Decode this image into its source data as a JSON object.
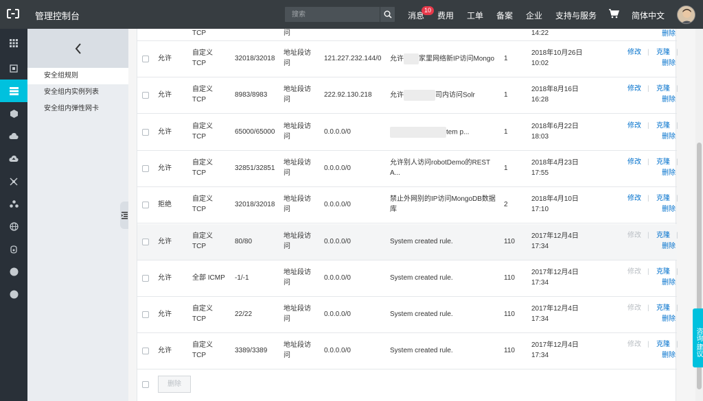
{
  "topbar": {
    "console_title": "管理控制台",
    "search_placeholder": "搜索",
    "nav": {
      "messages": "消息",
      "messages_badge": "10",
      "fees": "费用",
      "tickets": "工单",
      "icp": "备案",
      "enterprise": "企业",
      "support": "支持与服务",
      "language": "简体中文"
    }
  },
  "subnav": {
    "items": [
      {
        "label": "安全组规则"
      },
      {
        "label": "安全组内实例列表"
      },
      {
        "label": "安全组内弹性网卡"
      }
    ]
  },
  "table": {
    "top_partial": {
      "protocol": "TCP",
      "auth": "问",
      "date": "14:22",
      "delete": "删除"
    },
    "rows": [
      {
        "policy": "允许",
        "protocol1": "自定义",
        "protocol2": "TCP",
        "port": "32018/32018",
        "auth1": "地址段访",
        "auth2": "问",
        "object": "121.227.232.144/0",
        "desc_pre": "允许",
        "desc_post": "家里网络新IP访问Mongo",
        "desc_line2": "",
        "priority": "1",
        "date1": "2018年10月26日",
        "date2": "10:02",
        "edit": "修改",
        "clone": "克隆",
        "delete": "删除",
        "sep": "|"
      },
      {
        "policy": "允许",
        "protocol1": "自定义",
        "protocol2": "TCP",
        "port": "8983/8983",
        "auth1": "地址段访",
        "auth2": "问",
        "object": "222.92.130.218",
        "desc_pre": "允许",
        "desc_post": "司内访问Solr",
        "desc_line2": "",
        "priority": "1",
        "date1": "2018年8月16日",
        "date2": "16:28",
        "edit": "修改",
        "clone": "克隆",
        "delete": "删除",
        "sep": "|"
      },
      {
        "policy": "允许",
        "protocol1": "自定义",
        "protocol2": "TCP",
        "port": "65000/65000",
        "auth1": "地址段访",
        "auth2": "问",
        "object": "0.0.0.0/0",
        "desc_pre": "",
        "desc_post": "tem p...",
        "desc_line2": "",
        "priority": "1",
        "date1": "2018年6月22日",
        "date2": "18:03",
        "edit": "修改",
        "clone": "克隆",
        "delete": "删除",
        "sep": "|"
      },
      {
        "policy": "允许",
        "protocol1": "自定义",
        "protocol2": "TCP",
        "port": "32851/32851",
        "auth1": "地址段访",
        "auth2": "问",
        "object": "0.0.0.0/0",
        "desc_pre": "允许别人访问robotDemo的REST",
        "desc_post": "",
        "desc_line2": "A...",
        "priority": "1",
        "date1": "2018年4月23日",
        "date2": "17:55",
        "edit": "修改",
        "clone": "克隆",
        "delete": "删除",
        "sep": "|"
      },
      {
        "policy": "拒绝",
        "protocol1": "自定义",
        "protocol2": "TCP",
        "port": "32018/32018",
        "auth1": "地址段访",
        "auth2": "问",
        "object": "0.0.0.0/0",
        "desc_pre": "禁止外网别的IP访问MongoDB数据",
        "desc_post": "",
        "desc_line2": "库",
        "priority": "2",
        "date1": "2018年4月10日",
        "date2": "17:10",
        "edit": "修改",
        "clone": "克隆",
        "delete": "删除",
        "sep": "|"
      },
      {
        "policy": "允许",
        "protocol1": "自定义",
        "protocol2": "TCP",
        "port": "80/80",
        "auth1": "地址段访",
        "auth2": "问",
        "object": "0.0.0.0/0",
        "desc_pre": "System created rule.",
        "desc_post": "",
        "desc_line2": "",
        "priority": "110",
        "date1": "2017年12月4日",
        "date2": "17:34",
        "edit": "修改",
        "clone": "克隆",
        "delete": "删除",
        "sep": "|"
      },
      {
        "policy": "允许",
        "protocol1": "全部 ICMP",
        "protocol2": "",
        "port": "-1/-1",
        "auth1": "地址段访",
        "auth2": "问",
        "object": "0.0.0.0/0",
        "desc_pre": "System created rule.",
        "desc_post": "",
        "desc_line2": "",
        "priority": "110",
        "date1": "2017年12月4日",
        "date2": "17:34",
        "edit": "修改",
        "clone": "克隆",
        "delete": "删除",
        "sep": "|"
      },
      {
        "policy": "允许",
        "protocol1": "自定义",
        "protocol2": "TCP",
        "port": "22/22",
        "auth1": "地址段访",
        "auth2": "问",
        "object": "0.0.0.0/0",
        "desc_pre": "System created rule.",
        "desc_post": "",
        "desc_line2": "",
        "priority": "110",
        "date1": "2017年12月4日",
        "date2": "17:34",
        "edit": "修改",
        "clone": "克隆",
        "delete": "删除",
        "sep": "|"
      },
      {
        "policy": "允许",
        "protocol1": "自定义",
        "protocol2": "TCP",
        "port": "3389/3389",
        "auth1": "地址段访",
        "auth2": "问",
        "object": "0.0.0.0/0",
        "desc_pre": "System created rule.",
        "desc_post": "",
        "desc_line2": "",
        "priority": "110",
        "date1": "2017年12月4日",
        "date2": "17:34",
        "edit": "修改",
        "clone": "克隆",
        "delete": "删除",
        "sep": "|"
      }
    ],
    "delete_button": "删除"
  },
  "feedback": {
    "label": "咨询·建议"
  },
  "colors": {
    "topbar": "#373d41",
    "iconbar": "#293038",
    "accent": "#00c1de",
    "link": "#0070cc",
    "badge": "#e8394a"
  },
  "icons": [
    "logo-icon",
    "search-icon",
    "cart-icon",
    "grid-icon",
    "chevron-left-icon",
    "list-toggle-icon"
  ]
}
